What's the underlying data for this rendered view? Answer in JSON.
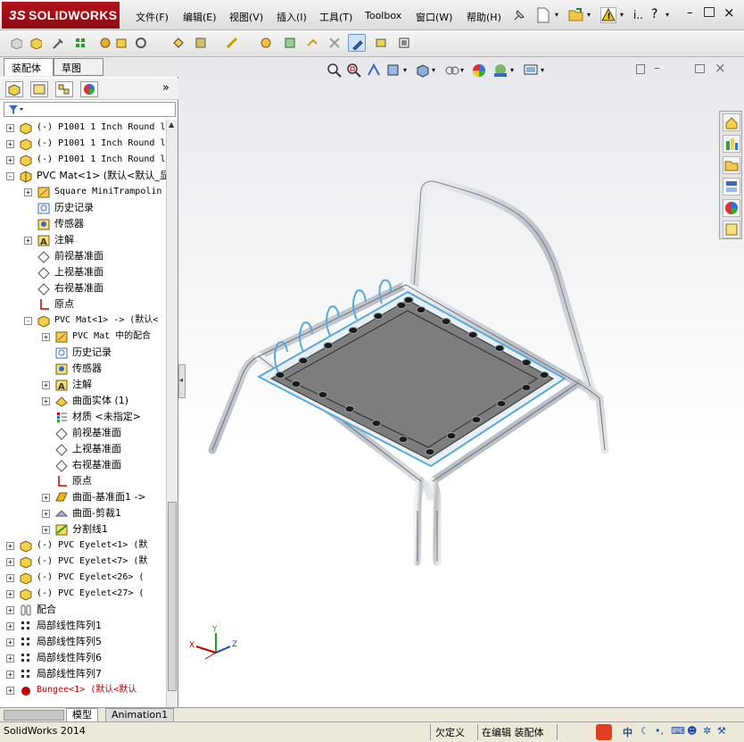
{
  "app": {
    "logo_text": "SOLIDWORKS",
    "menu": [
      "文件(F)",
      "编辑(E)",
      "视图(V)",
      "插入(I)",
      "工具(T)",
      "Toolbox",
      "窗口(W)",
      "帮助(H)"
    ],
    "search_label": "i.."
  },
  "panel": {
    "tabs": [
      "装配体",
      "草图"
    ],
    "expand_label": "»"
  },
  "tree": [
    {
      "label": "(-) P1001 1 Inch Round l",
      "mono": true
    },
    {
      "label": "(-) P1001 1 Inch Round l",
      "mono": true
    },
    {
      "label": "(-) P1001 1 Inch Round l",
      "mono": true
    },
    {
      "label": "PVC Mat<1> (默认<默认_显",
      "mono": false
    },
    {
      "label": "Square MiniTrampolin",
      "mono": true
    },
    {
      "label": "历史记录",
      "mono": false
    },
    {
      "label": "传感器",
      "mono": false
    },
    {
      "label": "注解",
      "mono": false
    },
    {
      "label": "前视基准面",
      "mono": false
    },
    {
      "label": "上视基准面",
      "mono": false
    },
    {
      "label": "右视基准面",
      "mono": false
    },
    {
      "label": "原点",
      "mono": false
    },
    {
      "label": "PVC Mat<1> -> (默认<",
      "mono": true
    },
    {
      "label": "PVC Mat 中的配合",
      "mono": true
    },
    {
      "label": "历史记录",
      "mono": false
    },
    {
      "label": "传感器",
      "mono": false
    },
    {
      "label": "注解",
      "mono": false
    },
    {
      "label": "曲面实体 (1)",
      "mono": false
    },
    {
      "label": "材质 <未指定>",
      "mono": false
    },
    {
      "label": "前视基准面",
      "mono": false
    },
    {
      "label": "上视基准面",
      "mono": false
    },
    {
      "label": "右视基准面",
      "mono": false
    },
    {
      "label": "原点",
      "mono": false
    },
    {
      "label": "曲面-基准面1 ->",
      "mono": false
    },
    {
      "label": "曲面-剪裁1",
      "mono": false
    },
    {
      "label": "分割线1",
      "mono": false
    },
    {
      "label": "(-) PVC Eyelet<1> (默",
      "mono": true
    },
    {
      "label": "(-) PVC Eyelet<7> (默",
      "mono": true
    },
    {
      "label": "(-) PVC Eyelet<26> (",
      "mono": true
    },
    {
      "label": "(-) PVC Eyelet<27> (",
      "mono": true
    },
    {
      "label": "配合",
      "mono": false
    },
    {
      "label": "局部线性阵列1",
      "mono": false
    },
    {
      "label": "局部线性阵列5",
      "mono": false
    },
    {
      "label": "局部线性阵列6",
      "mono": false
    },
    {
      "label": "局部线性阵列7",
      "mono": false
    },
    {
      "label": "Bungee<1> (默认<默认",
      "mono": true
    }
  ],
  "bottom_tabs": [
    "模型",
    "Animation1"
  ],
  "triad": {
    "x": "X",
    "y": "Y",
    "z": "Z"
  },
  "status": {
    "app_version": "SolidWorks 2014",
    "state1": "欠定义",
    "state2": "在编辑 装配体",
    "ime": "中"
  },
  "colors": {
    "brand": "#b5121b",
    "mat": "#7d7d7d",
    "frame": "#c9cdd2",
    "bungee": "#5aa9d6"
  }
}
